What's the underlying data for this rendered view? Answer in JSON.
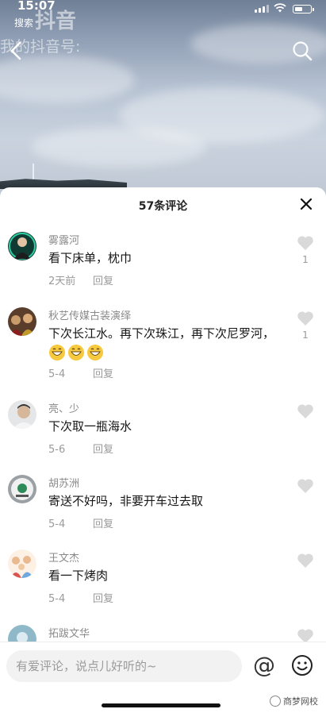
{
  "status_bar": {
    "time": "15:07"
  },
  "video": {
    "search_label": "搜索",
    "watermark_logo": "抖音",
    "watermark_id": "我的抖音号: "
  },
  "comments_panel": {
    "title": "57条评论",
    "comments": [
      {
        "user": "雾露河",
        "text": "看下床单，枕巾",
        "date": "2天前",
        "reply": "回复",
        "likes": "1"
      },
      {
        "user": "秋艺传媒古装演绎",
        "text": "下次长江水。再下次珠江，再下次尼罗河，",
        "date": "5-4",
        "reply": "回复",
        "likes": "1"
      },
      {
        "user": "亮、少",
        "text": "下次取一瓶海水",
        "date": "5-6",
        "reply": "回复",
        "likes": ""
      },
      {
        "user": "胡苏洲",
        "text": "寄送不好吗，非要开车过去取",
        "date": "5-4",
        "reply": "回复",
        "likes": ""
      },
      {
        "user": "王文杰",
        "text": "看一下烤肉",
        "date": "5-4",
        "reply": "回复",
        "likes": ""
      },
      {
        "user": "拓跋文华",
        "text": "",
        "date": "",
        "reply": "",
        "likes": ""
      }
    ]
  },
  "input_bar": {
    "placeholder": "有爱评论，说点儿好听的~",
    "at_symbol": "@",
    "source_mark": "商梦网校"
  }
}
